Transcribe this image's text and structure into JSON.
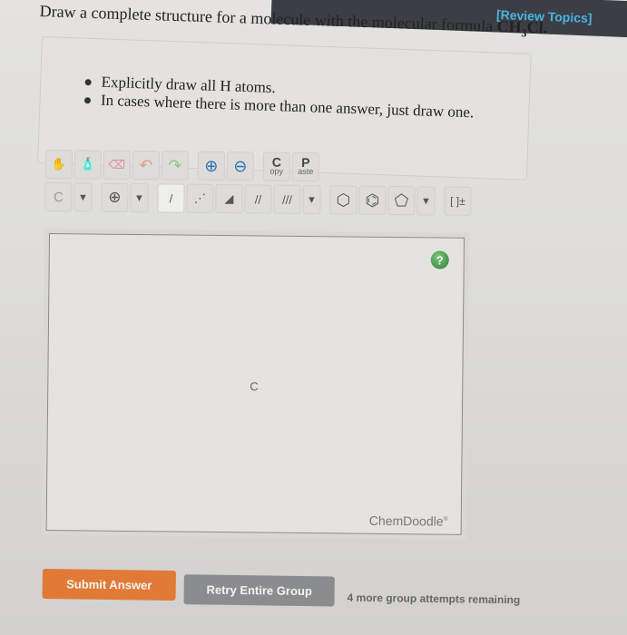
{
  "header": {
    "review_link": "[Review Topics]"
  },
  "question": {
    "text": "Draw a complete structure for a molecule with the molecular formula ",
    "formula": {
      "c": "CH",
      "sub": "3",
      "rest": "Cl."
    }
  },
  "hints": [
    "Explicitly draw all H atoms.",
    "In cases where there is more than one answer, just draw one."
  ],
  "toolbar": {
    "row1": [
      {
        "name": "hand-tool",
        "icon": "✋"
      },
      {
        "name": "clear-tool",
        "icon": "🧴"
      },
      {
        "name": "erase-tool",
        "icon": "⌫"
      },
      {
        "name": "undo-tool",
        "icon": "↶"
      },
      {
        "name": "redo-tool",
        "icon": "↷"
      },
      {
        "name": "zoom-in-tool",
        "icon": "⊕"
      },
      {
        "name": "zoom-out-tool",
        "icon": "⊖"
      }
    ],
    "copy": {
      "big": "C",
      "small": "opy"
    },
    "paste": {
      "big": "P",
      "small": "aste"
    },
    "row2": {
      "atom_label": "C",
      "charge_icon": "⊕",
      "dropdown": "▾",
      "bonds": [
        "/",
        "⋰",
        "◢",
        "//",
        "///"
      ],
      "rings": [
        "⬡",
        "⌬",
        "⬠"
      ],
      "bracket": "[ ]±"
    }
  },
  "canvas": {
    "atom": "C",
    "help": "?",
    "brand": "ChemDoodle",
    "brand_mark": "®"
  },
  "actions": {
    "submit": "Submit Answer",
    "retry": "Retry Entire Group",
    "attempts": "4 more group attempts remaining"
  },
  "colors": {
    "submit": "#e07a36",
    "retry": "#8b8c8d",
    "link": "#4ab3e0"
  }
}
